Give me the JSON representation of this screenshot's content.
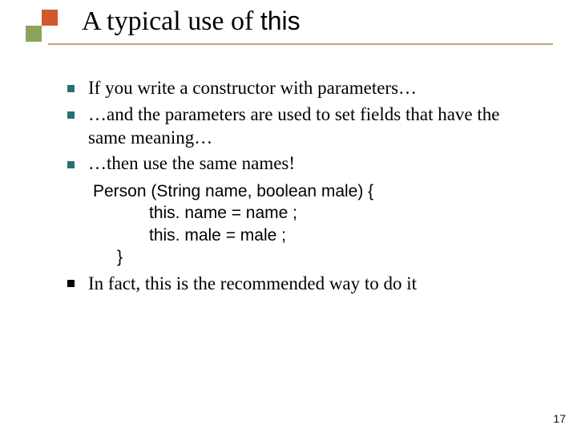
{
  "title": {
    "prefix": "A typical use of ",
    "keyword": "this"
  },
  "bullets": [
    "If you write a constructor with parameters…",
    "…and the parameters are used to set fields that have the same meaning…",
    "…then use the same names!"
  ],
  "code": {
    "line1": "Person (String name, boolean male) {",
    "line2": "this. name = name ;",
    "line3": "this. male = male ;",
    "line4": "}"
  },
  "closing": "In fact, this is the recommended way to do it",
  "page_number": "17"
}
